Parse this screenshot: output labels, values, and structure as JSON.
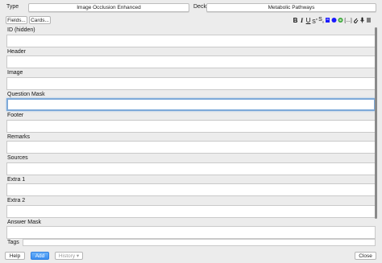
{
  "header": {
    "type_label": "Type",
    "type_value": "Image Occlusion Enhanced",
    "deck_label": "Deck",
    "deck_value": "Metabolic Pathways"
  },
  "toolbar": {
    "fields_button": "Fields...",
    "cards_button": "Cards...",
    "format_icons": [
      "bold-icon",
      "italic-icon",
      "underline-icon",
      "superscript-icon",
      "subscript-icon",
      "clear-format-icon",
      "text-color-icon",
      "highlight-icon",
      "cloze-icon",
      "attach-icon",
      "record-audio-icon",
      "more-icon"
    ],
    "format_glyphs": {
      "bold": "B",
      "italic": "I",
      "underline": "U",
      "superscript": "S",
      "subscript": "S",
      "cloze": "[…]"
    },
    "text_color": "#1a1aff",
    "highlight_color": "#3aa63a"
  },
  "fields": [
    {
      "label": "ID (hidden)",
      "value": ""
    },
    {
      "label": "Header",
      "value": ""
    },
    {
      "label": "Image",
      "value": ""
    },
    {
      "label": "Question Mask",
      "value": "",
      "focused": true
    },
    {
      "label": "Footer",
      "value": ""
    },
    {
      "label": "Remarks",
      "value": ""
    },
    {
      "label": "Sources",
      "value": ""
    },
    {
      "label": "Extra 1",
      "value": ""
    },
    {
      "label": "Extra 2",
      "value": ""
    },
    {
      "label": "Answer Mask",
      "value": ""
    }
  ],
  "tags": {
    "label": "Tags",
    "value": ""
  },
  "bottom": {
    "help": "Help",
    "add": "Add",
    "history": "History ▾",
    "close": "Close"
  },
  "colors": {
    "focus": "#7eaad9",
    "primary": "#3b8ef0"
  }
}
